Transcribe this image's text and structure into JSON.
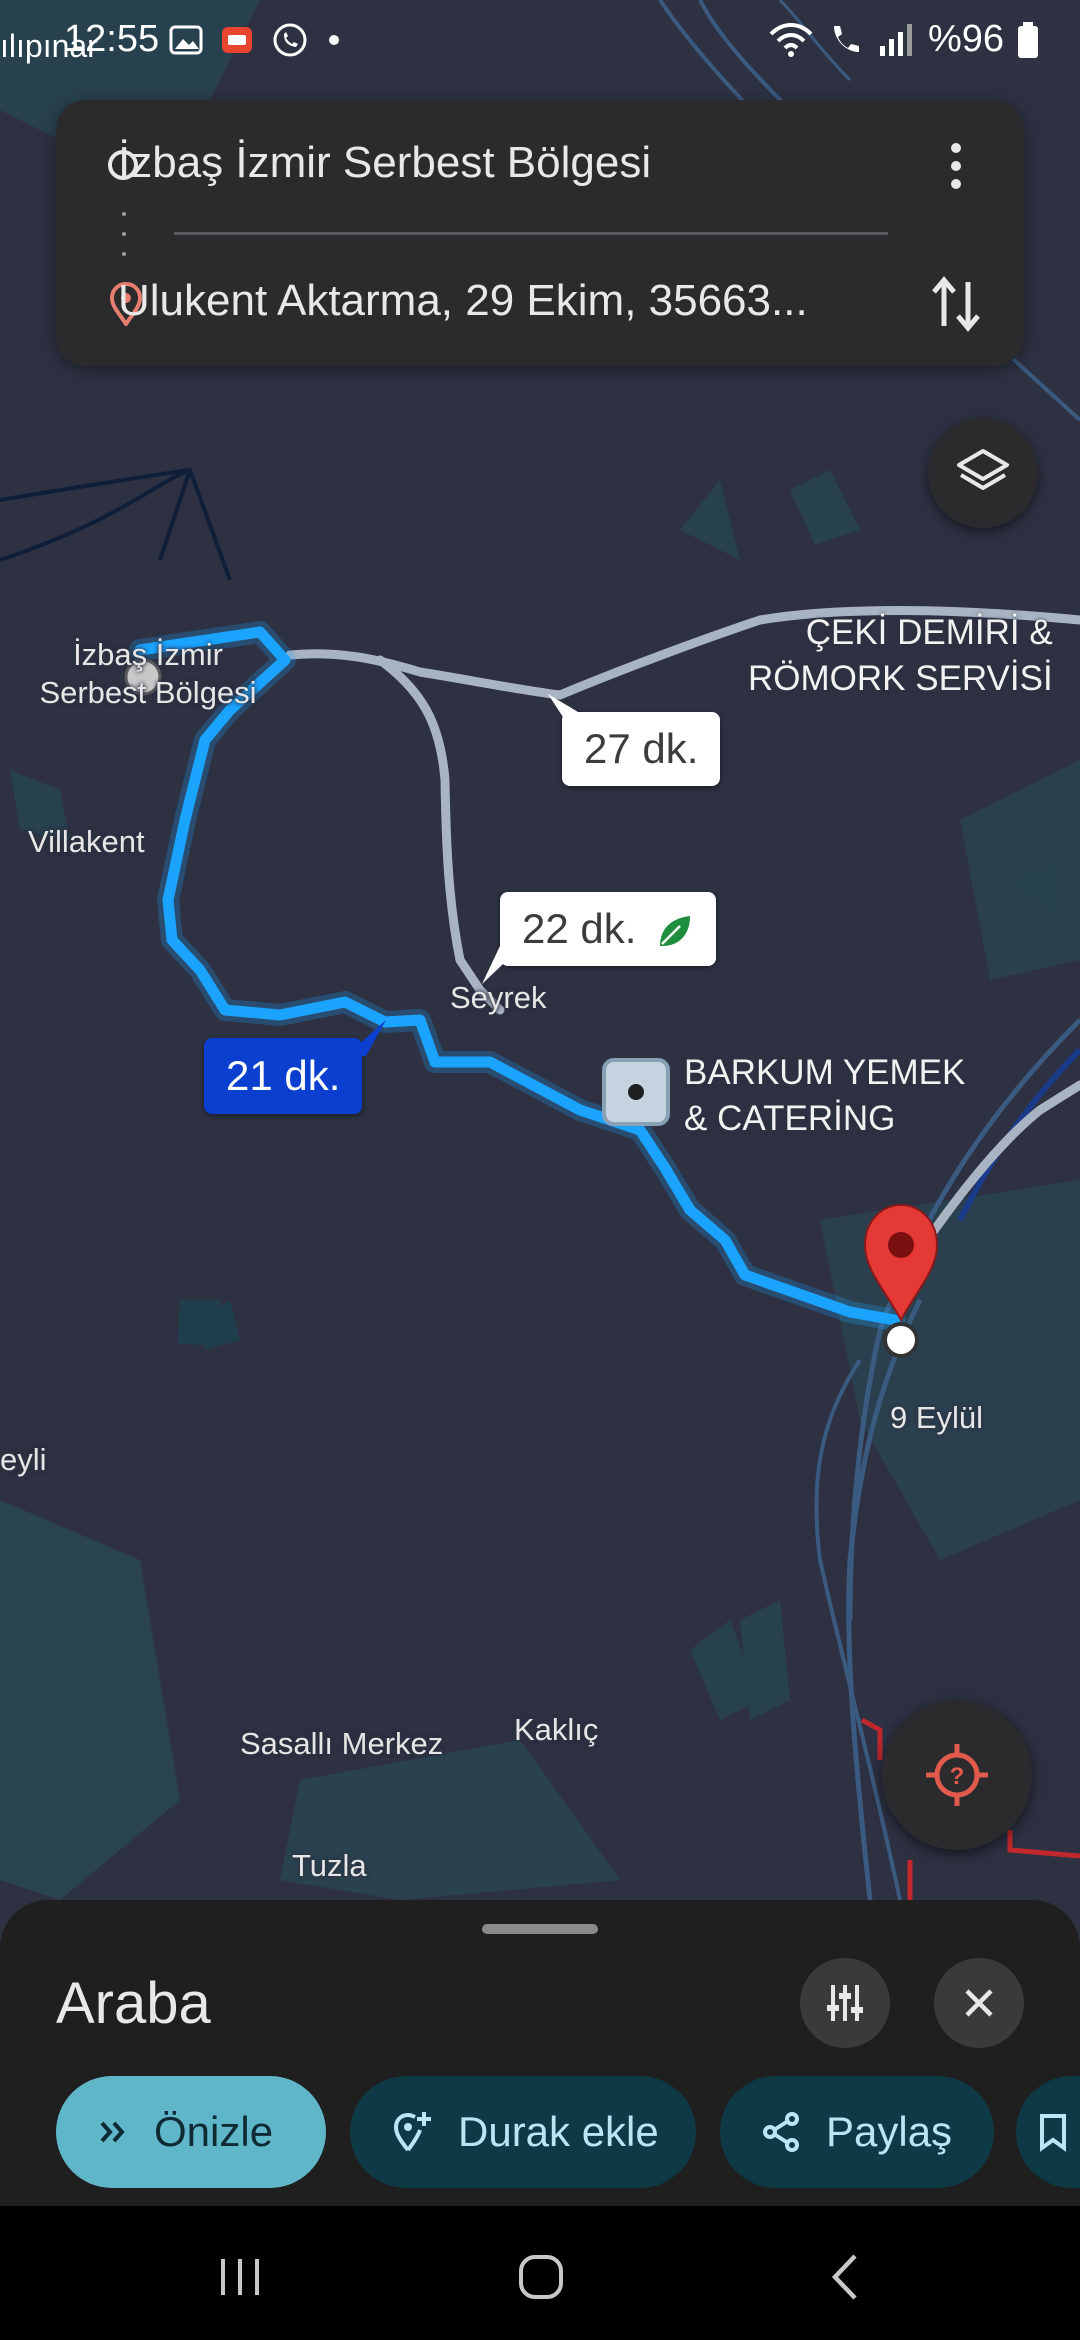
{
  "status_bar": {
    "left_partial": "ılıpınar",
    "time": "12:55",
    "battery": "%96"
  },
  "search": {
    "origin": "İzbaş İzmir Serbest Bölgesi",
    "destination": "Ulukent Aktarma, 29 Ekim, 35663..."
  },
  "map_labels": {
    "origin_area": "İzbaş İzmir Serbest Bölgesi",
    "villakent": "Villakent",
    "seyrek": "Seyrek",
    "dokuz_eylul": "9 Eylül",
    "beyli_partial": "eyli",
    "sasalli": "Sasallı Merkez",
    "kaklic": "Kaklıç",
    "tuzla": "Tuzla",
    "poi_ceki_line1": "ÇEKİ DEMİRİ &",
    "poi_ceki_line2": "RÖMORK SERVİSİ",
    "poi_barkum_line1": "BARKUM YEMEK",
    "poi_barkum_line2": "& CATERİNG"
  },
  "routes": [
    {
      "duration": "21 dk.",
      "selected": true
    },
    {
      "duration": "22 dk.",
      "selected": false,
      "eco": true
    },
    {
      "duration": "27 dk.",
      "selected": false
    }
  ],
  "sheet": {
    "mode": "Araba",
    "chips": {
      "preview": "Önizle",
      "add_stop": "Durak ekle",
      "share": "Paylaş"
    }
  },
  "colors": {
    "map_bg": "#2d3142",
    "route_selected": "#1aa3ff",
    "route_alt": "#a9b4c2",
    "destination_pin": "#e53935",
    "chip_primary": "#5fb6c9",
    "chip_secondary": "#0d3a45"
  }
}
